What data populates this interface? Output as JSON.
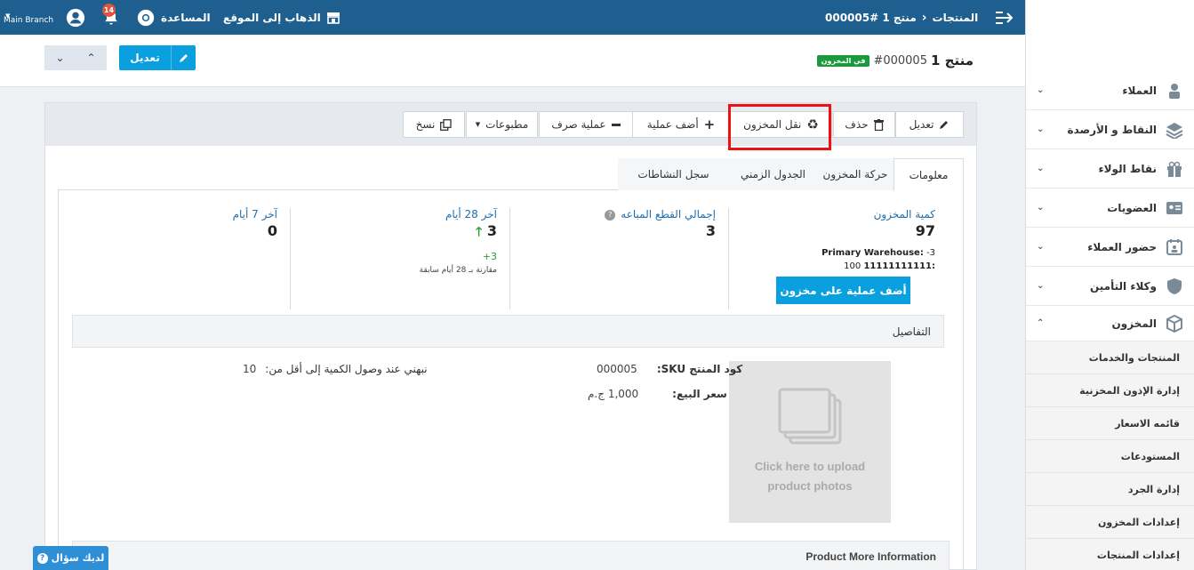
{
  "topbar": {
    "branch": "Main Branch",
    "notifications_count": "14",
    "help_label": "المساعدة",
    "goto_site_label": "الذهاب إلى الموقع",
    "breadcrumb_parent": "المنتجات",
    "breadcrumb_current": "منتج 1 #000005"
  },
  "header": {
    "title": "منتج 1",
    "product_id": "#000005",
    "stock_badge": "في المخزون",
    "edit_label": "تعديل"
  },
  "toolbar": {
    "edit": "تعديل",
    "delete": "حذف",
    "transfer": "نقل المخزون",
    "add_operation": "أضف عملية",
    "issue_operation": "عملية صرف",
    "prints": "مطبوعات",
    "copy": "نسخ"
  },
  "tabs": {
    "info": "معلومات",
    "stock_movement": "حركة المخزون",
    "timeline": "الجدول الزمني",
    "activity_log": "سجل النشاطات"
  },
  "stats": {
    "qty_label": "كمية المخزون",
    "qty_value": "97",
    "warehouse_name": "Primary Warehouse:",
    "warehouse_value": "-3",
    "warehouse2_name": "11111111111:",
    "warehouse2_value": "100",
    "add_stock_button": "أضف عملية على مخزون",
    "sold_label": "إجمالي القطع المباعه",
    "sold_value": "3",
    "last28_label": "آخر 28 أيام",
    "last28_value": "3",
    "last28_change": "3+",
    "last28_compare": "مقارنة بـ 28 أيام سابقة",
    "last7_label": "آخر 7 أيام",
    "last7_value": "0"
  },
  "details": {
    "section_title": "التفاصيل",
    "photo_upload_line1": "Click here to upload",
    "photo_upload_line2": "product photos",
    "sku_label": "كود المنتج SKU:",
    "sku_value": "000005",
    "price_label": "سعر البيع:",
    "price_value": "1,000 ج.م",
    "alert_label": "نبهني عند وصول الكمية إلى أقل من:",
    "alert_value": "10",
    "more_info": "Product More Information"
  },
  "sidebar": {
    "items": [
      {
        "label": "العملاء"
      },
      {
        "label": "النقاط و الأرصدة"
      },
      {
        "label": "نقاط الولاء"
      },
      {
        "label": "العضويات"
      },
      {
        "label": "حضور العملاء"
      },
      {
        "label": "وكلاء التأمين"
      },
      {
        "label": "المخزون"
      }
    ],
    "subitems": [
      {
        "label": "المنتجات والخدمات"
      },
      {
        "label": "إدارة الإذون المخزنية"
      },
      {
        "label": "قائمه الاسعار"
      },
      {
        "label": "المستودعات"
      },
      {
        "label": "إدارة الجرد"
      },
      {
        "label": "إعدادات المخزون"
      },
      {
        "label": "إعدادات المنتجات"
      }
    ]
  },
  "ask_button": "لديك سؤال",
  "colors": {
    "topbar": "#1f5f8f",
    "primary": "#0aa0e0",
    "success": "#1a9a3c",
    "highlight": "#ee1111"
  }
}
